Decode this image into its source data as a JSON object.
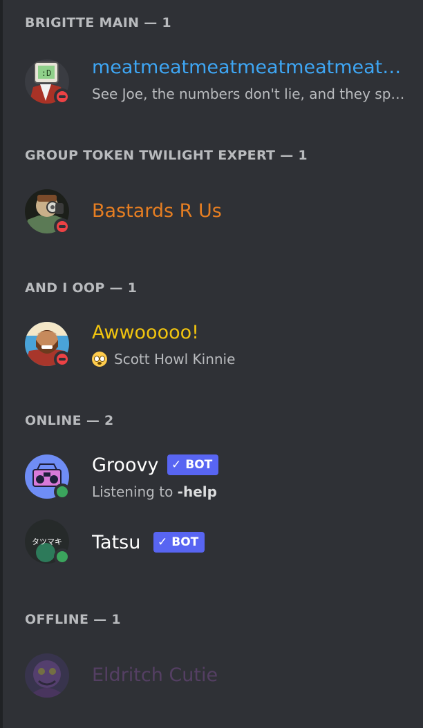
{
  "groups": [
    {
      "header": "BRIGITTE MAIN — 1"
    },
    {
      "header": "GROUP TOKEN TWILIGHT EXPERT — 1"
    },
    {
      "header": "AND I OOP — 1"
    },
    {
      "header": "ONLINE — 2"
    },
    {
      "header": "OFFLINE — 1"
    }
  ],
  "members": {
    "meat": {
      "name": "meatmeatmeatmeatmeatmeatm…",
      "status_text": "See Joe, the numbers don't lie, and they spel…",
      "name_color": "#3ea6f4",
      "status": "dnd",
      "avatar_icon": "tv-head-avatar"
    },
    "bastards": {
      "name": "Bastards R Us",
      "name_color": "#e67e22",
      "status": "dnd",
      "avatar_icon": "gas-mask-avatar"
    },
    "awoo": {
      "name": "Awwooooo!",
      "status_text": "Scott Howl Kinnie",
      "status_emoji": "flushed-face-emoji",
      "name_color": "#f1c40f",
      "status": "dnd",
      "avatar_icon": "bearded-man-avatar"
    },
    "groovy": {
      "name": "Groovy",
      "bot_label": "BOT",
      "activity_prefix": "Listening to ",
      "activity_bold": "-help",
      "name_color": "#ffffff",
      "status": "online",
      "avatar_icon": "boombox-avatar"
    },
    "tatsu": {
      "name": "Tatsu",
      "bot_label": "BOT",
      "avatar_text": "タツマキ",
      "name_color": "#ffffff",
      "status": "online",
      "avatar_icon": "tatsu-avatar"
    },
    "eldritch": {
      "name": "Eldritch Cutie",
      "name_color": "#9b59b6",
      "status": "offline",
      "avatar_icon": "purple-creature-avatar"
    }
  },
  "colors": {
    "background": "#2f3136",
    "blurple": "#5865f2",
    "online": "#3ba55d",
    "dnd": "#ed4245"
  }
}
